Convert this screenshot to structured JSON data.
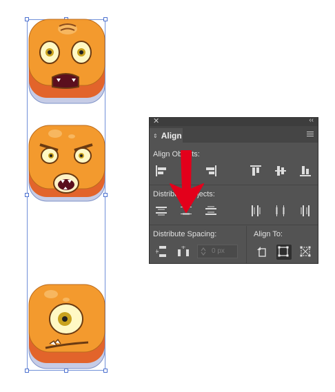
{
  "panel": {
    "close_glyph": "✕",
    "collapse_glyph": "‹‹",
    "tab_label": "Align",
    "tab_arrows_glyph": "⇕",
    "menu_icon": "hamburger-menu-icon"
  },
  "sections": {
    "align_objects_label": "Align Objects:",
    "distribute_objects_label": "Distribute Objects:",
    "distribute_spacing_label": "Distribute Spacing:",
    "align_to_label": "Align To:"
  },
  "spacing_field": {
    "value": "0 px"
  },
  "annotation": {
    "arrow_color": "#e3001b"
  },
  "colors": {
    "panel_bg": "#535353",
    "selection_stroke": "#6f8fd8",
    "monster_orange": "#f39a2e"
  }
}
